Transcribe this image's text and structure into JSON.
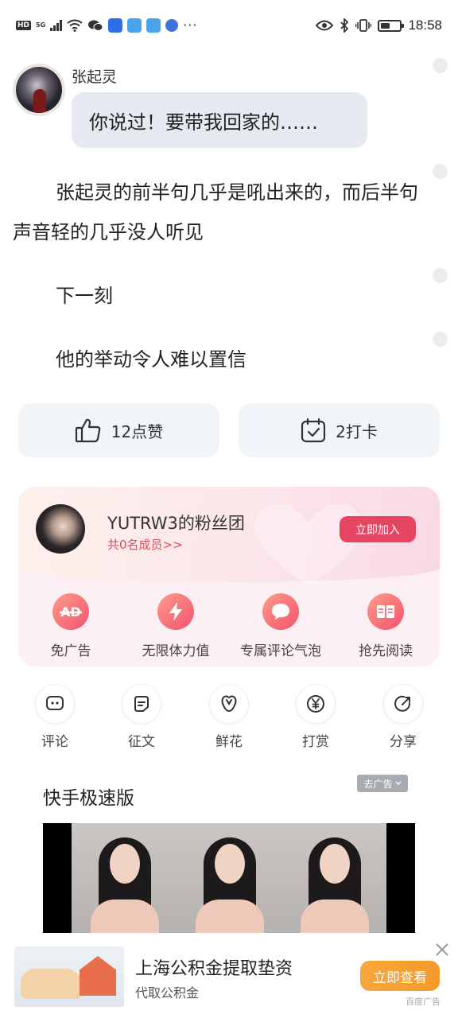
{
  "status_bar": {
    "hd": "HD",
    "network": "5G",
    "overflow": "···",
    "time": "18:58",
    "battery_level": 0.5,
    "app_icon_colors": [
      "#2c6fe6",
      "#4aa3e8",
      "#4aa3e8",
      "#3b73d9"
    ]
  },
  "message": {
    "speaker": "张起灵",
    "text": "你说过！要带我回家的……"
  },
  "paragraphs": [
    "张起灵的前半句几乎是吼出来的，而后半句声音轻的几乎没人听见",
    "下一刻",
    "他的举动令人难以置信"
  ],
  "actions": {
    "like": "12点赞",
    "checkin": "2打卡"
  },
  "fan_club": {
    "title": "YUTRW3的粉丝团",
    "members": "共0名成员>>",
    "join": "立即加入",
    "perks": [
      "免广告",
      "无限体力值",
      "专属评论气泡",
      "抢先阅读"
    ]
  },
  "tools": [
    "评论",
    "征文",
    "鲜花",
    "打赏",
    "分享"
  ],
  "feed_ad": {
    "title": "快手极速版",
    "remove": "去广告"
  },
  "banner_ad": {
    "title": "上海公积金提取垫资",
    "subtitle": "代取公积金",
    "cta": "立即查看",
    "tag": "百度广告"
  },
  "colors": {
    "accent": "#e64562",
    "cta_orange": "#f5a135",
    "bubble": "#e4eaf0"
  }
}
